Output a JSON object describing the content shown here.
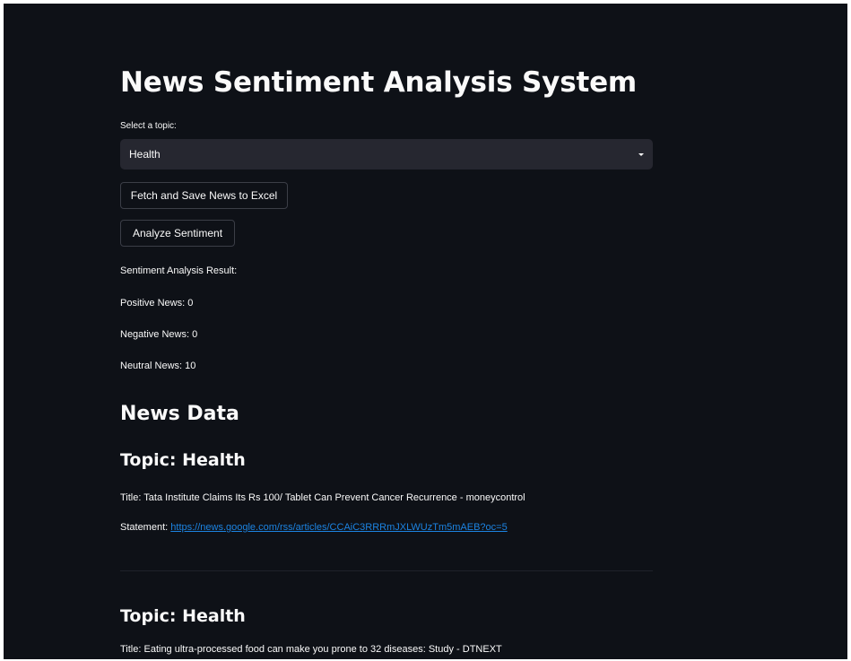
{
  "app": {
    "title": "News Sentiment Analysis System"
  },
  "topic_select": {
    "label": "Select a topic:",
    "selected": "Health"
  },
  "buttons": {
    "fetch_label": "Fetch and Save News to Excel",
    "analyze_label": "Analyze Sentiment"
  },
  "sentiment": {
    "heading": "Sentiment Analysis Result:",
    "positive": "Positive News: 0",
    "negative": "Negative News: 0",
    "neutral": "Neutral News: 10"
  },
  "news_data": {
    "heading": "News Data",
    "articles": [
      {
        "topic": "Topic: Health",
        "title": "Title: Tata Institute Claims Its Rs 100/ Tablet Can Prevent Cancer Recurrence - moneycontrol",
        "statement_label": "Statement: ",
        "statement_link": "https://news.google.com/rss/articles/CCAiC3RRRmJXLWUzTm5mAEB?oc=5"
      },
      {
        "topic": "Topic: Health",
        "title": "Title: Eating ultra-processed food can make you prone to 32 diseases: Study - DTNEXT"
      }
    ]
  },
  "colors": {
    "background": "#0e1117",
    "select_bg": "#262730",
    "text": "#fafafa",
    "link": "#1c83e1"
  }
}
